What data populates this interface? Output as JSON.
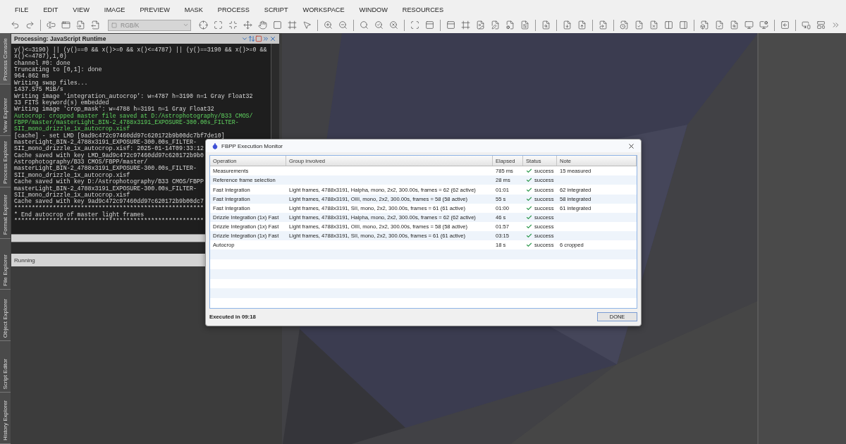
{
  "menu": [
    "FILE",
    "EDIT",
    "VIEW",
    "IMAGE",
    "PREVIEW",
    "MASK",
    "PROCESS",
    "SCRIPT",
    "WORKSPACE",
    "WINDOW",
    "RESOURCES"
  ],
  "toolbar": {
    "color_mode": {
      "value": "RGB/K",
      "disabled": true
    }
  },
  "side_tabs": [
    {
      "label": "Process Console",
      "selected": true
    },
    {
      "label": "View Explorer",
      "selected": false
    },
    {
      "label": "Process Explorer",
      "selected": false
    },
    {
      "label": "Format Explorer",
      "selected": false
    },
    {
      "label": "File Explorer",
      "selected": false
    },
    {
      "label": "Object Explorer",
      "selected": false
    },
    {
      "label": "Script Editor",
      "selected": false
    },
    {
      "label": "History Explorer",
      "selected": false
    }
  ],
  "console": {
    "title": "Processing: JavaScript Runtime",
    "status": "Running",
    "lines": [
      {
        "text": "y()<=3190) || (y()==0 && x()>=0 && x()<=4787) || (y()==3190 && x()>=0 &&",
        "kind": "plain"
      },
      {
        "text": "x()<=4787),1,0)",
        "kind": "plain"
      },
      {
        "text": "channel #0: done",
        "kind": "plain"
      },
      {
        "text": "Truncating to [0,1]: done",
        "kind": "plain"
      },
      {
        "text": "964.862 ms",
        "kind": "plain"
      },
      {
        "text": "Writing swap files...",
        "kind": "plain"
      },
      {
        "text": "1437.575 MiB/s",
        "kind": "plain"
      },
      {
        "text": "Writing image 'integration_autocrop': w=4787 h=3190 n=1 Gray Float32",
        "kind": "plain"
      },
      {
        "text": "33 FITS keyword(s) embedded",
        "kind": "plain"
      },
      {
        "text": "Writing image 'crop_mask': w=4788 h=3191 n=1 Gray Float32",
        "kind": "plain"
      },
      {
        "text": "Autocrop: cropped master file saved at D:/Astrophotography/B33 CMOS/",
        "kind": "success"
      },
      {
        "text": "FBPP/master/masterLight_BIN-2_4788x3191_EXPOSURE-300.00s_FILTER-",
        "kind": "success"
      },
      {
        "text": "SII_mono_drizzle_1x_autocrop.xisf",
        "kind": "success"
      },
      {
        "text": "[cache] - set LMD [9ad9c472c97460dd97c620172b9b00dc7bf7de10]",
        "kind": "plain"
      },
      {
        "text": "masterLight_BIN-2_4788x3191_EXPOSURE-300.00s_FILTER-",
        "kind": "plain"
      },
      {
        "text": "SII_mono_drizzle_1x_autocrop.xisf: 2025-01-14T09:33:12",
        "kind": "plain"
      },
      {
        "text": "Cache saved with key LMD_9ad9c472c97460dd97c620172b9b0",
        "kind": "plain"
      },
      {
        "text": "Astrophotography/B33 CMOS/FBPP/master/",
        "kind": "plain"
      },
      {
        "text": "masterLight_BIN-2_4788x3191_EXPOSURE-300.00s_FILTER-",
        "kind": "plain"
      },
      {
        "text": "SII_mono_drizzle_1x_autocrop.xisf",
        "kind": "plain"
      },
      {
        "text": "Cache saved with key D:/Astrophotography/B33 CMOS/FBPP",
        "kind": "plain"
      },
      {
        "text": "masterLight_BIN-2_4788x3191_EXPOSURE-300.00s_FILTER-",
        "kind": "plain"
      },
      {
        "text": "SII_mono_drizzle_1x_autocrop.xisf",
        "kind": "plain"
      },
      {
        "text": "Cache saved with key 9ad9c472c97460dd97c620172b9b00dc7",
        "kind": "plain"
      },
      {
        "text": "******************************************************",
        "kind": "plain"
      },
      {
        "text": "* End autocrop of master light frames",
        "kind": "plain"
      },
      {
        "text": "******************************************************",
        "kind": "plain"
      }
    ]
  },
  "dialog": {
    "title": "FBPP Execution Monitor",
    "columns": [
      "Operation",
      "Group involved",
      "Elapsed",
      "Status",
      "Note"
    ],
    "rows": [
      {
        "operation": "Measurements",
        "group": "",
        "elapsed": "785 ms",
        "status": "success",
        "succeeded": true,
        "note": "15 measured"
      },
      {
        "operation": "Reference frame selection",
        "group": "",
        "elapsed": "28 ms",
        "status": "success",
        "succeeded": true,
        "note": ""
      },
      {
        "operation": "Fast Integration",
        "group": "Light frames, 4788x3191, Halpha, mono, 2x2, 300.00s, frames = 62 (62 active)",
        "elapsed": "01:01",
        "status": "success",
        "succeeded": true,
        "note": "62 integrated"
      },
      {
        "operation": "Fast Integration",
        "group": "Light frames, 4788x3191, OIII, mono, 2x2, 300.00s, frames = 58 (58 active)",
        "elapsed": "55 s",
        "status": "success",
        "succeeded": true,
        "note": "58 integrated"
      },
      {
        "operation": "Fast Integration",
        "group": "Light frames, 4788x3191, SII, mono, 2x2, 300.00s, frames = 61 (61 active)",
        "elapsed": "01:00",
        "status": "success",
        "succeeded": true,
        "note": "61 integrated"
      },
      {
        "operation": "Drizzle Integration (1x) Fast",
        "group": "Light frames, 4788x3191, Halpha, mono, 2x2, 300.00s, frames = 62 (62 active)",
        "elapsed": "46 s",
        "status": "success",
        "succeeded": true,
        "note": ""
      },
      {
        "operation": "Drizzle Integration (1x) Fast",
        "group": "Light frames, 4788x3191, OIII, mono, 2x2, 300.00s, frames = 58 (58 active)",
        "elapsed": "01:57",
        "status": "success",
        "succeeded": true,
        "note": ""
      },
      {
        "operation": "Drizzle Integration (1x) Fast",
        "group": "Light frames, 4788x3191, SII, mono, 2x2, 300.00s, frames = 61 (61 active)",
        "elapsed": "03:15",
        "status": "success",
        "succeeded": true,
        "note": ""
      },
      {
        "operation": "Autocrop",
        "group": "",
        "elapsed": "18 s",
        "status": "success",
        "succeeded": true,
        "note": "6 cropped"
      }
    ],
    "footer": "Executed in 09:18",
    "button": "DONE"
  }
}
